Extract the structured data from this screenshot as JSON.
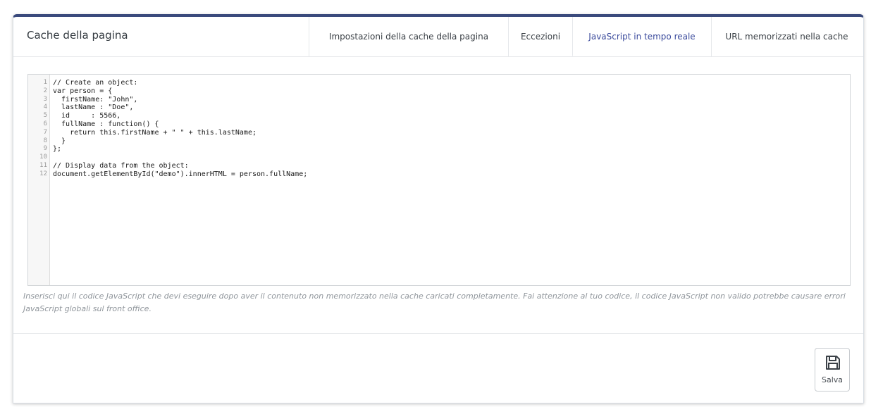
{
  "panel": {
    "title": "Cache della pagina"
  },
  "tabs": [
    {
      "label": "Impostazioni della cache della pagina"
    },
    {
      "label": "Eccezioni"
    },
    {
      "label": "JavaScript in tempo reale",
      "active": true
    },
    {
      "label": "URL memorizzati nella cache"
    }
  ],
  "editor": {
    "lines": [
      {
        "num": "1",
        "text": "// Create an object:"
      },
      {
        "num": "2",
        "text": "var person = {"
      },
      {
        "num": "3",
        "text": "  firstName: \"John\","
      },
      {
        "num": "4",
        "text": "  lastName : \"Doe\","
      },
      {
        "num": "5",
        "text": "  id     : 5566,"
      },
      {
        "num": "6",
        "text": "  fullName : function() {"
      },
      {
        "num": "7",
        "text": "    return this.firstName + \" \" + this.lastName;"
      },
      {
        "num": "8",
        "text": "  }"
      },
      {
        "num": "9",
        "text": "};"
      },
      {
        "num": "10",
        "text": ""
      },
      {
        "num": "11",
        "text": "// Display data from the object:"
      },
      {
        "num": "12",
        "text": "document.getElementById(\"demo\").innerHTML = person.fullName;"
      }
    ]
  },
  "help_text": "Inserisci qui il codice JavaScript che devi eseguire dopo aver il contenuto non memorizzato nella cache caricati completamente. Fai attenzione al tuo codice, il codice JavaScript non valido potrebbe causare errori JavaScript globali sul front office.",
  "footer": {
    "save_label": "Salva",
    "save_icon": "floppy-disk-icon"
  },
  "colors": {
    "accent": "#3a4a9c",
    "top_border": "#3a4a7c",
    "help_text": "#8f959b"
  }
}
